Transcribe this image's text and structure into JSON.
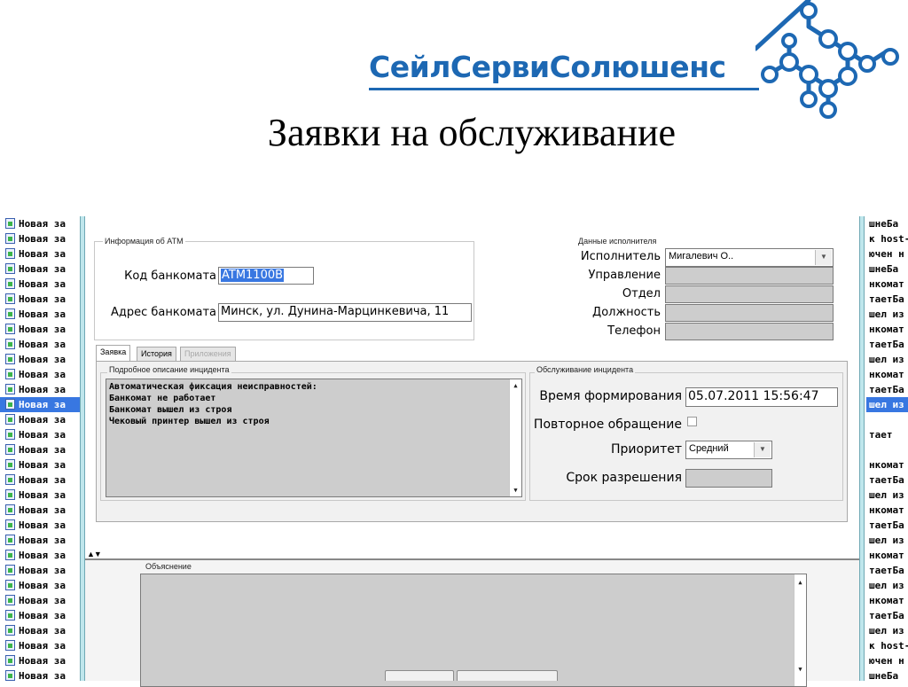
{
  "header": {
    "brand": "СейлСервиСолюшенс",
    "title": "Заявки на обслуживание"
  },
  "left_list": {
    "item_label": "Новая за",
    "count": 31,
    "selected_index": 12
  },
  "right_list": {
    "items": [
      "шнеБа",
      "к host-",
      "ючен н",
      "шнеБа",
      "нкомат",
      "таетБа",
      "шел из",
      "нкомат",
      "таетБа",
      "шел из",
      "нкомат",
      "таетБа",
      "шел из",
      "",
      "тает",
      "",
      "нкомат",
      "таетБа",
      "шел из",
      "нкомат",
      "таетБа",
      "шел из",
      "нкомат",
      "таетБа",
      "шел из",
      "нкомат",
      "таетБа",
      "шел из",
      "к host-",
      "ючен н",
      "шнеБа"
    ],
    "selected_index": 12
  },
  "atm_info": {
    "group_label": "Информация об ATM",
    "code_label": "Код банкомата",
    "code_value": "ATM1100B",
    "address_label": "Адрес банкомата",
    "address_value": "Минск, ул. Дунина-Марцинкевича, 11"
  },
  "executor": {
    "group_label": "Данные исполнителя",
    "executor_label": "Исполнитель",
    "executor_value": "Мигалевич О..",
    "department_label": "Управление",
    "division_label": "Отдел",
    "position_label": "Должность",
    "phone_label": "Телефон"
  },
  "tabs": [
    {
      "label": "Заявка",
      "active": true
    },
    {
      "label": "История",
      "active": false
    },
    {
      "label": "Приложения",
      "disabled": true
    }
  ],
  "incident": {
    "group_label": "Подробное описание инцидента",
    "lines": [
      "Автоматическая фиксация неисправностей:",
      "Банкомат не работает",
      "Банкомат вышел из строя",
      "Чековый принтер вышел из строя"
    ]
  },
  "service": {
    "group_label": "Обслуживание инцидента",
    "created_label": "Время формирования",
    "created_value": "05.07.2011 15:56:47",
    "repeat_label": "Повторное обращение",
    "repeat_checked": false,
    "priority_label": "Приоритет",
    "priority_value": "Средний",
    "deadline_label": "Срок разрешения"
  },
  "explanation": {
    "group_label": "Объяснение"
  },
  "colors": {
    "brand": "#1d68b3",
    "selection": "#3877e1",
    "readonly_field": "#cdcdcd"
  }
}
